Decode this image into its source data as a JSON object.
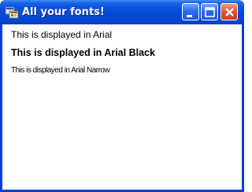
{
  "window": {
    "title": "All your fonts!",
    "icon": "app-window-icon",
    "caption_buttons": [
      "minimize-icon",
      "maximize-icon",
      "close-icon"
    ]
  },
  "content": {
    "lines": [
      "This is displayed in Arial",
      "This is displayed in Arial Black",
      "This is displayed in Arial Narrow"
    ]
  },
  "colors": {
    "titlebar": "#0548d2",
    "close_button": "#e0583a",
    "client_background": "#ffffff"
  }
}
